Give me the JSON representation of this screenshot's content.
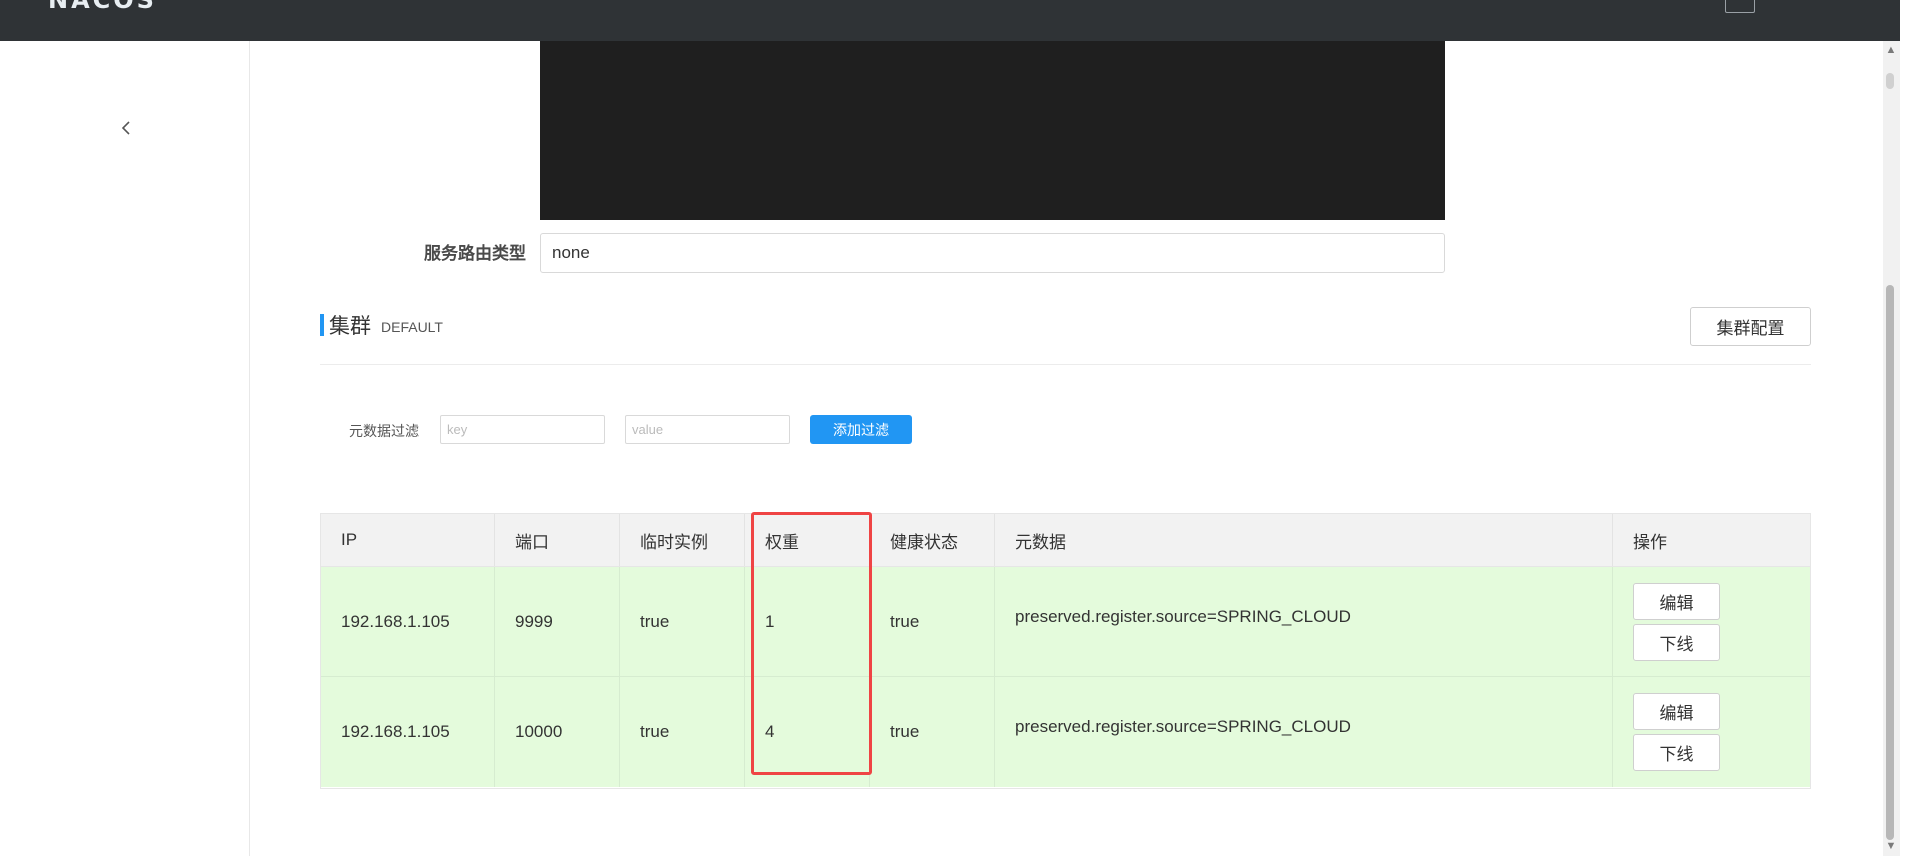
{
  "topbar": {
    "logo_fragment": "NACOS",
    "right_control_icon": "menu-box-icon"
  },
  "sidebar": {
    "collapse_icon": "chevron-left-icon"
  },
  "form": {
    "route_type_label": "服务路由类型",
    "route_type_value": "none"
  },
  "cluster": {
    "title": "集群",
    "name": "DEFAULT",
    "config_button": "集群配置"
  },
  "filter": {
    "label": "元数据过滤",
    "key_placeholder": "key",
    "value_placeholder": "value",
    "add_button": "添加过滤"
  },
  "table": {
    "headers": [
      "IP",
      "端口",
      "临时实例",
      "权重",
      "健康状态",
      "元数据",
      "操作"
    ],
    "rows": [
      {
        "ip": "192.168.1.105",
        "port": "9999",
        "ephemeral": "true",
        "weight": "1",
        "healthy": "true",
        "metadata": "preserved.register.source=SPRING_CLOUD",
        "edit": "编辑",
        "offline": "下线"
      },
      {
        "ip": "192.168.1.105",
        "port": "10000",
        "ephemeral": "true",
        "weight": "4",
        "healthy": "true",
        "metadata": "preserved.register.source=SPRING_CLOUD",
        "edit": "编辑",
        "offline": "下线"
      }
    ]
  },
  "colors": {
    "accent": "#2196f3",
    "row_healthy_bg": "#e4fbdc",
    "highlight": "#ef4444",
    "topbar": "#2f3336"
  }
}
